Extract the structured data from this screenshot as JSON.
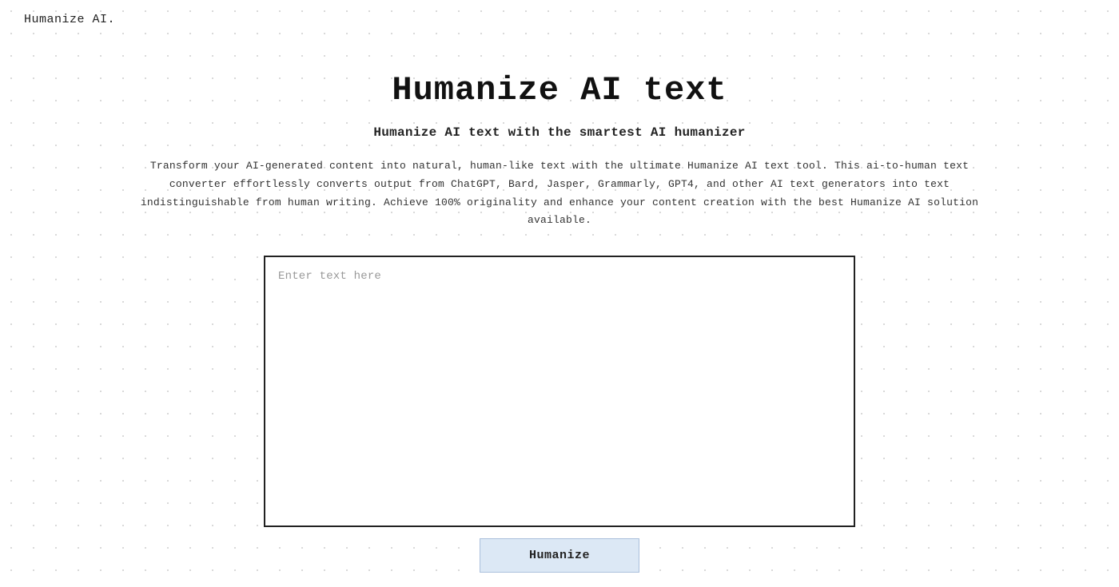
{
  "header": {
    "logo_text": "Humanize AI."
  },
  "main": {
    "title": "Humanize AI text",
    "subtitle": "Humanize AI text with the smartest AI humanizer",
    "description": "Transform your AI-generated content into natural, human-like text with the ultimate Humanize AI text tool. This ai-to-human text converter effortlessly converts output from ChatGPT, Bard, Jasper, Grammarly, GPT4, and other AI text generators into text indistinguishable from human writing. Achieve 100% originality and enhance your content creation with the best Humanize AI solution available.",
    "textarea_placeholder": "Enter text here",
    "humanize_button_label": "Humanize"
  }
}
